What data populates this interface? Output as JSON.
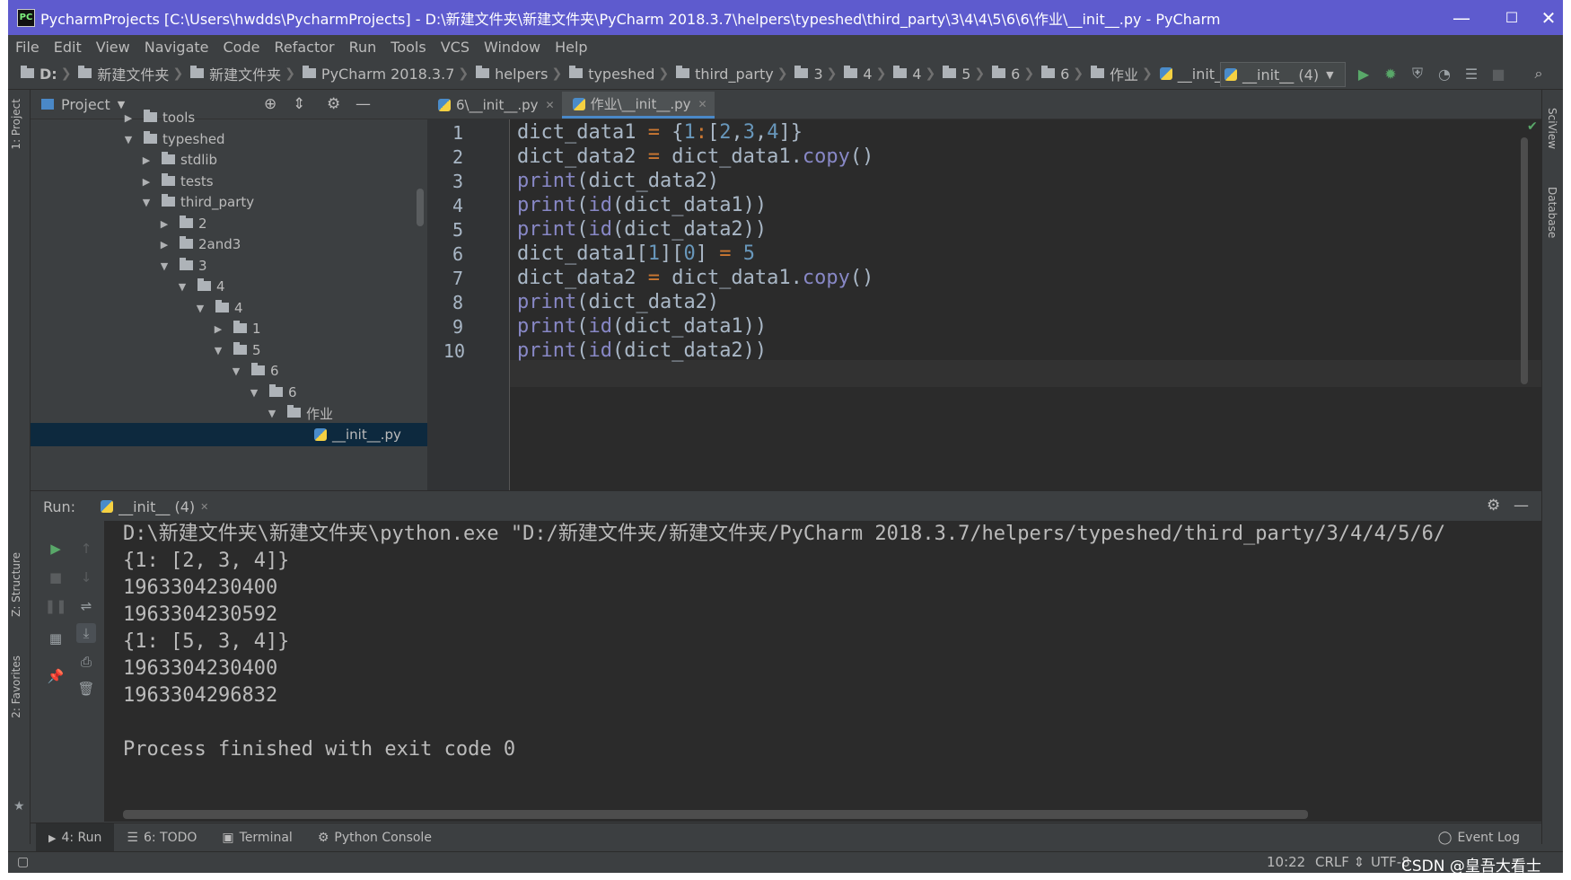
{
  "window": {
    "title": "PycharmProjects [C:\\Users\\hwdds\\PycharmProjects] - D:\\新建文件夹\\新建文件夹\\PyCharm 2018.3.7\\helpers\\typeshed\\third_party\\3\\4\\4\\5\\6\\6\\作业\\__init__.py - PyCharm",
    "app_icon": "PC",
    "minimize": "—",
    "maximize": "☐",
    "close": "✕"
  },
  "menu": [
    "File",
    "Edit",
    "View",
    "Navigate",
    "Code",
    "Refactor",
    "Run",
    "Tools",
    "VCS",
    "Window",
    "Help"
  ],
  "breadcrumb": [
    "D:",
    "新建文件夹",
    "新建文件夹",
    "PyCharm 2018.3.7",
    "helpers",
    "typeshed",
    "third_party",
    "3",
    "4",
    "4",
    "5",
    "6",
    "6",
    "作业",
    "__init__.py"
  ],
  "run_config": {
    "label": "__init__ (4)"
  },
  "project_panel": {
    "title": "Project",
    "tree": [
      {
        "label": "tools",
        "expanded": false
      },
      {
        "label": "typeshed",
        "expanded": true
      },
      {
        "label": "stdlib",
        "expanded": false
      },
      {
        "label": "tests",
        "expanded": false
      },
      {
        "label": "third_party",
        "expanded": true
      },
      {
        "label": "2",
        "expanded": false
      },
      {
        "label": "2and3",
        "expanded": false
      },
      {
        "label": "3",
        "expanded": true
      },
      {
        "label": "4",
        "expanded": true
      },
      {
        "label": "4",
        "expanded": true
      },
      {
        "label": "1",
        "expanded": false
      },
      {
        "label": "5",
        "expanded": true
      },
      {
        "label": "6",
        "expanded": true
      },
      {
        "label": "6",
        "expanded": true
      },
      {
        "label": "作业",
        "expanded": true
      },
      {
        "label": "__init__.py",
        "expanded": null
      }
    ]
  },
  "editor_tabs": [
    {
      "label": "6\\__init__.py",
      "active": false
    },
    {
      "label": "作业\\__init__.py",
      "active": true
    }
  ],
  "code": {
    "line_numbers": [
      "1",
      "2",
      "3",
      "4",
      "5",
      "6",
      "7",
      "8",
      "9",
      "10"
    ],
    "lines": [
      "dict_data1 = {1:[2,3,4]}",
      "dict_data2 = dict_data1.copy()",
      "print(dict_data2)",
      "print(id(dict_data1))",
      "print(id(dict_data2))",
      "dict_data1[1][0] = 5",
      "dict_data2 = dict_data1.copy()",
      "print(dict_data2)",
      "print(id(dict_data1))",
      "print(id(dict_data2))"
    ],
    "current_line": "10"
  },
  "run_panel": {
    "label": "Run:",
    "tab": "__init__ (4)",
    "output": [
      "D:\\新建文件夹\\新建文件夹\\python.exe \"D:/新建文件夹/新建文件夹/PyCharm 2018.3.7/helpers/typeshed/third_party/3/4/4/5/6/",
      "{1: [2, 3, 4]}",
      "1963304230400",
      "1963304230592",
      "{1: [5, 3, 4]}",
      "1963304230400",
      "1963304296832",
      "",
      "Process finished with exit code 0"
    ]
  },
  "tool_tabs": [
    {
      "label": "4: Run",
      "icon": "play-icon",
      "active": true
    },
    {
      "label": "6: TODO",
      "icon": "list-icon",
      "active": false
    },
    {
      "label": "Terminal",
      "icon": "terminal-icon",
      "active": false
    },
    {
      "label": "Python Console",
      "icon": "python-icon",
      "active": false
    }
  ],
  "event_log": "Event Log",
  "left_stripe": {
    "project": "1: Project",
    "structure": "Z: Structure",
    "favorites": "2: Favorites"
  },
  "right_stripe": {
    "sciview": "SciView",
    "database": "Database"
  },
  "status": {
    "position": "10:22",
    "line_sep": "CRLF ⇕",
    "encoding": "UTF-8",
    "watermark": "CSDN @皇吾大看士"
  },
  "colors": {
    "titlebar": "#5e5bce",
    "panel": "#3c3f41",
    "editor_bg": "#2b2b2b",
    "keyword_fn": "#8888c6",
    "operator": "#cc7832",
    "number": "#6897bb",
    "run_green": "#59a869"
  }
}
